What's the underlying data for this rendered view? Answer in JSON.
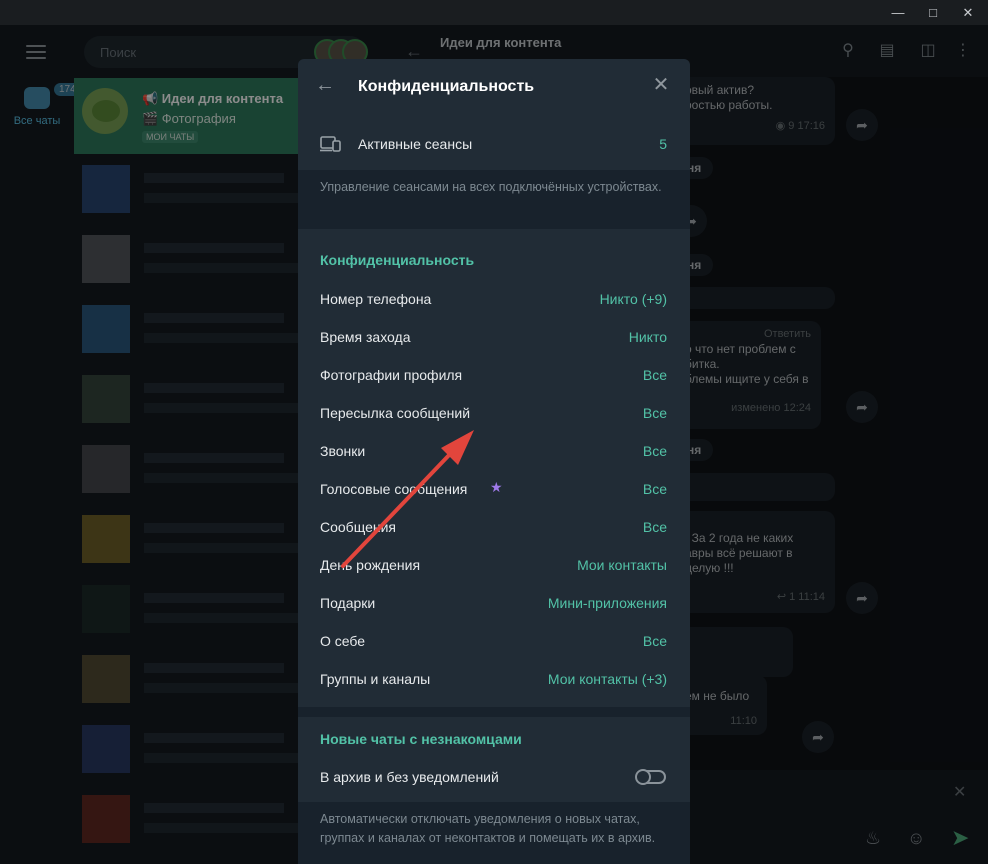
{
  "background": {
    "search_placeholder": "Поиск",
    "folder_all": "Все чаты",
    "folder_badge": "174",
    "active_chat": {
      "title": "📢 Идеи для контента",
      "preview": "🎬 Фотография",
      "tag": "МОИ ЧАТЫ"
    },
    "chat_header_title": "Идеи для контента",
    "fragments": {
      "msg1": "овый актив?",
      "msg2": "ростью работы.",
      "msg1_meta_views": "9",
      "msg1_meta_time": "17:16",
      "date1": "ня",
      "date2": "ня",
      "date3": "ня",
      "date4": "ня",
      "reply_label": "Ответить",
      "msg3_l1": "о что нет проблем с",
      "msg3_l2": "битка.",
      "msg3_l3": "блемы ищите у себя в",
      "msg3_meta": "изменено 12:24",
      "msg4_l1": "! За 2 года не каких",
      "msg4_l2": "авры всё решают в",
      "msg4_l3": "делую !!!",
      "msg4_meta": "1 11:14",
      "msg5": "ем не было",
      "msg5_meta": "11:10"
    }
  },
  "modal": {
    "title": "Конфиденциальность",
    "active_sessions": {
      "label": "Активные сеансы",
      "value": "5"
    },
    "sessions_note": "Управление сеансами на всех подключённых устройствах.",
    "privacy_section": "Конфиденциальность",
    "privacy_rows": [
      {
        "label": "Номер телефона",
        "value": "Никто (+9)"
      },
      {
        "label": "Время захода",
        "value": "Никто"
      },
      {
        "label": "Фотографии профиля",
        "value": "Все"
      },
      {
        "label": "Пересылка сообщений",
        "value": "Все"
      },
      {
        "label": "Звонки",
        "value": "Все"
      },
      {
        "label": "Голосовые сообщения",
        "value": "Все",
        "premium": true
      },
      {
        "label": "Сообщения",
        "value": "Все"
      },
      {
        "label": "День рождения",
        "value": "Мои контакты"
      },
      {
        "label": "Подарки",
        "value": "Мини-приложения"
      },
      {
        "label": "О себе",
        "value": "Все"
      },
      {
        "label": "Группы и каналы",
        "value": "Мои контакты (+3)"
      }
    ],
    "new_chats_section": "Новые чаты с незнакомцами",
    "archive_row": {
      "label": "В архив и без уведомлений",
      "enabled": false
    },
    "archive_note": "Автоматически отключать уведомления о новых чатах, группах и каналах от неконтактов и помещать их в архив."
  },
  "colors": {
    "accent": "#52c2a7",
    "arrow": "#e2453c",
    "premium_star": "#9f7aea"
  }
}
